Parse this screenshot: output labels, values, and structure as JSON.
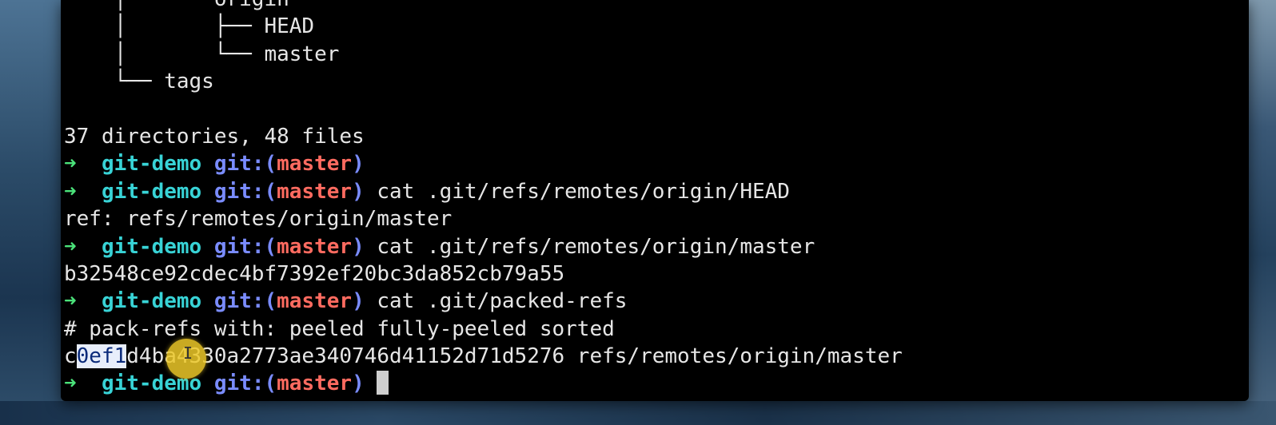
{
  "terminal": {
    "lines": [
      {
        "kind": "plain",
        "text": "    │   └── origin"
      },
      {
        "kind": "plain",
        "text": "    │       ├── HEAD"
      },
      {
        "kind": "plain",
        "text": "    │       └── master"
      },
      {
        "kind": "plain",
        "text": "    └── tags"
      },
      {
        "kind": "plain",
        "text": ""
      },
      {
        "kind": "plain",
        "text": "37 directories, 48 files"
      },
      {
        "kind": "prompt",
        "command": ""
      },
      {
        "kind": "prompt",
        "command": "cat .git/refs/remotes/origin/HEAD"
      },
      {
        "kind": "plain",
        "text": "ref: refs/remotes/origin/master"
      },
      {
        "kind": "prompt",
        "command": "cat .git/refs/remotes/origin/master"
      },
      {
        "kind": "plain",
        "text": "b32548ce92cdec4bf7392ef20bc3da852cb79a55"
      },
      {
        "kind": "prompt",
        "command": "cat .git/packed-refs"
      },
      {
        "kind": "plain",
        "text": "# pack-refs with: peeled fully-peeled sorted"
      },
      {
        "kind": "selected",
        "before": "c",
        "selected": "0ef1",
        "after": "d4ba4330a2773ae340746d41152d71d5276 refs/remotes/origin/master"
      },
      {
        "kind": "prompt",
        "command": "",
        "cursor": true
      }
    ],
    "prompt": {
      "arrow": "➜",
      "dir": "git-demo",
      "git_label": "git:(",
      "branch": "master",
      "git_close": ")"
    }
  },
  "colors": {
    "background": "#000000",
    "text": "#e6e6e6",
    "arrow": "#4be37a",
    "dir": "#38d3d6",
    "git_label": "#7a8cff",
    "branch": "#ff6b60",
    "selection": "#e8eefb",
    "pointer_highlight": "#ecc828"
  },
  "icons": {
    "pointer": "ibeam-cursor-icon",
    "text_cursor": "block-cursor"
  }
}
